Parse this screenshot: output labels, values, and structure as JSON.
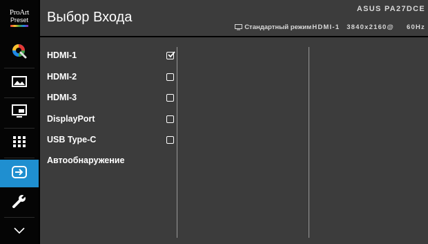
{
  "logo": {
    "line1": "ProArt",
    "line2": "Preset"
  },
  "header": {
    "title": "Выбор Входа",
    "model": "ASUS PA27DCE",
    "status": {
      "mode": "Стандартный режим",
      "source": "HDMI-1",
      "resolution": "3840x2160@",
      "refresh": "60Hz"
    }
  },
  "sidebar": {
    "items": [
      {
        "name": "color",
        "icon": "palette-icon"
      },
      {
        "name": "image",
        "icon": "landscape-image-icon"
      },
      {
        "name": "pip",
        "icon": "picture-in-picture-icon"
      },
      {
        "name": "quick-fit",
        "icon": "grid-icon"
      },
      {
        "name": "input-select",
        "icon": "input-icon",
        "active": true
      },
      {
        "name": "system",
        "icon": "wrench-icon"
      },
      {
        "name": "more",
        "icon": "chevron-down-icon"
      }
    ]
  },
  "inputs": [
    {
      "label": "HDMI-1",
      "checked": true
    },
    {
      "label": "HDMI-2",
      "checked": false
    },
    {
      "label": "HDMI-3",
      "checked": false
    },
    {
      "label": "DisplayPort",
      "checked": false
    },
    {
      "label": "USB Type-C",
      "checked": false
    },
    {
      "label": "Автообнаружение",
      "checked": null
    }
  ],
  "colors": {
    "accent": "#1f8fd0",
    "panel": "#3c3c3c",
    "sidebar": "#050505"
  }
}
